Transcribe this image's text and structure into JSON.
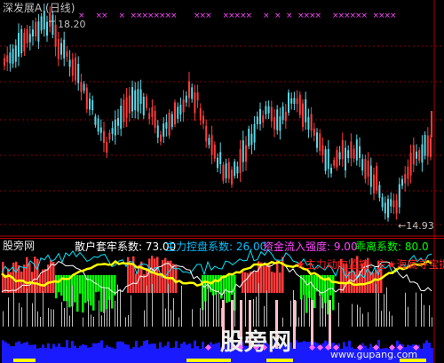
{
  "main": {
    "title": "深发展A (日线)",
    "high_label": "18.20",
    "low_label": "←14.93"
  },
  "indicator": {
    "brand": "股旁网",
    "coefficients": [
      {
        "label": "散户套牢系数: ",
        "value": "73.00"
      },
      {
        "label": "主力控盘系数: ",
        "value": "26.00"
      },
      {
        "label": "资金流入强度: ",
        "value": "9.00"
      },
      {
        "label": "乖离系数: ",
        "value": "80.0"
      }
    ],
    "alert": "★主力动向监控: 主★海底寻宝提"
  },
  "watermark": {
    "text": "股旁网",
    "sub": "www.gupang.com"
  },
  "colors": {
    "up": "#ff3b3b",
    "down": "#5ad7e6",
    "grid": "#8b0000",
    "cross": "#ff44ff",
    "yellow": "#ffff00",
    "green": "#00ff00",
    "blue": "#1a1aff",
    "white": "#ffffff",
    "coef1": "#ffffff",
    "coef2": "#00c0ff",
    "coef3": "#ff44ff",
    "coef4": "#00ff00",
    "alert": "#ff2020"
  }
}
